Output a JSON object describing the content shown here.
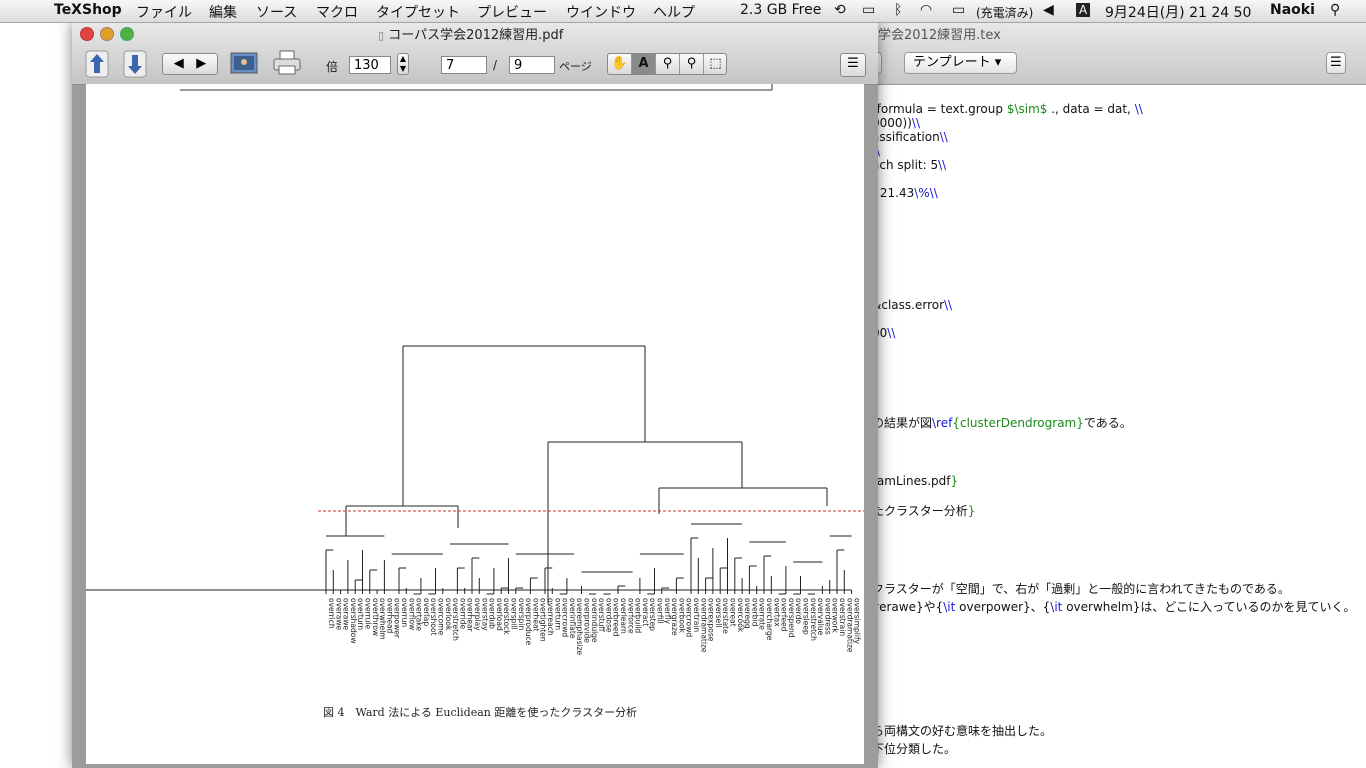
{
  "menubar": {
    "app": "TeXShop",
    "items": [
      "ファイル",
      "編集",
      "ソース",
      "マクロ",
      "タイプセット",
      "プレビュー",
      "ウインドウ",
      "ヘルプ"
    ],
    "memory": "2.3 GB Free",
    "battery": "(充電済み)",
    "input": "A",
    "datetime": "9月24日(月)  21 24 50",
    "user": "Naoki"
  },
  "tex_window": {
    "title": "学会2012練習用.tex",
    "template_label": "テンプレート",
    "lines": [
      {
        "parts": [
          {
            "t": "(formula = text.group "
          },
          {
            "t": "$\\sim$",
            "c": "green"
          },
          {
            "t": " ., data = dat, "
          },
          {
            "t": "\\\\",
            "c": "blue"
          }
        ]
      },
      {
        "parts": [
          {
            "t": "0000))"
          },
          {
            "t": "\\\\",
            "c": "blue"
          }
        ]
      },
      {
        "parts": [
          {
            "t": "assification"
          },
          {
            "t": "\\\\",
            "c": "blue"
          }
        ]
      },
      {
        "parts": [
          {
            "t": "\\\\",
            "c": "blue"
          }
        ]
      },
      {
        "parts": [
          {
            "t": "ach split: 5"
          },
          {
            "t": "\\\\",
            "c": "blue"
          }
        ]
      },
      {
        "parts": [
          {
            "t": ": 21.43"
          },
          {
            "t": "\\%\\\\",
            "c": "blue"
          }
        ]
      },
      {
        "parts": [
          {
            "t": "&class.error"
          },
          {
            "t": "\\\\",
            "c": "blue"
          }
        ]
      },
      {
        "parts": [
          {
            "t": "00"
          },
          {
            "t": "\\\\",
            "c": "blue"
          }
        ]
      },
      {
        "parts": [
          {
            "t": "の結果が図"
          },
          {
            "t": "\\ref",
            "c": "blue"
          },
          {
            "t": "{clusterDendrogram}",
            "c": "green"
          },
          {
            "t": "である。"
          }
        ]
      },
      {
        "parts": [
          {
            "t": "ramLines.pdf"
          },
          {
            "t": "}",
            "c": "green"
          }
        ]
      },
      {
        "parts": [
          {
            "t": "たクラスター分析"
          },
          {
            "t": "}",
            "c": "green"
          }
        ]
      },
      {
        "parts": [
          {
            "t": "クラスターが「空間」で、右が「過剰」と一般的に言われてきたものである。"
          }
        ]
      },
      {
        "parts": [
          {
            "t": "verawe}や{"
          },
          {
            "t": "\\it",
            "c": "blue"
          },
          {
            "t": " overpower}、{"
          },
          {
            "t": "\\it",
            "c": "blue"
          },
          {
            "t": " overwhelm}は、どこに入っているのかを見ていく。"
          }
        ]
      },
      {
        "parts": [
          {
            "t": "ら両構文の好む意味を抽出した。"
          }
        ]
      },
      {
        "parts": [
          {
            "t": "下位分類した。"
          }
        ]
      }
    ]
  },
  "pdf_window": {
    "title": "コーパス学会2012練習用.pdf",
    "zoom_label": "倍",
    "zoom": "130",
    "page_current": "7",
    "page_sep": "/",
    "page_total": "9",
    "page_suffix": "ページ",
    "tools": [
      "hand-tool",
      "text-select-tool",
      "magnify-tool",
      "magnify-region-tool",
      "marquee-select-tool"
    ],
    "figure_caption": "図 4　Ward 法による Euclidean 距離を使ったクラスター分析",
    "dendrogram_leaves": [
      "overrich",
      "overawe",
      "overawe",
      "overshadow",
      "overturn",
      "overrule",
      "overthrow",
      "overwhelm",
      "overhead",
      "overpower",
      "overrun",
      "overflow",
      "overtake",
      "overlap",
      "overshoot",
      "overcome",
      "overlook",
      "overstretch",
      "override",
      "overhear",
      "overplay",
      "overstay",
      "overdub",
      "overload",
      "overstock",
      "overspill",
      "overspin",
      "overproduce",
      "overheat",
      "overtighten",
      "overreach",
      "overturn",
      "overcrowd",
      "overinflate",
      "overemphasize",
      "overprovide",
      "overindulge",
      "overstuff",
      "overdose",
      "overbreed",
      "overlearn",
      "overforce",
      "overbuild",
      "overact",
      "overstep",
      "overfill",
      "overfly",
      "overgraze",
      "overbook",
      "overcrowd",
      "overtrain",
      "overdramatize",
      "overexpose",
      "oversell",
      "overstate",
      "overeat",
      "overcook",
      "overegg",
      "overbid",
      "overrate",
      "overcharge",
      "overtax",
      "overfeed",
      "overspend",
      "overdo",
      "oversleep",
      "overstretch",
      "overvalue",
      "overdress",
      "overwork",
      "overstrain",
      "overdramatize",
      "oversimplify"
    ]
  }
}
